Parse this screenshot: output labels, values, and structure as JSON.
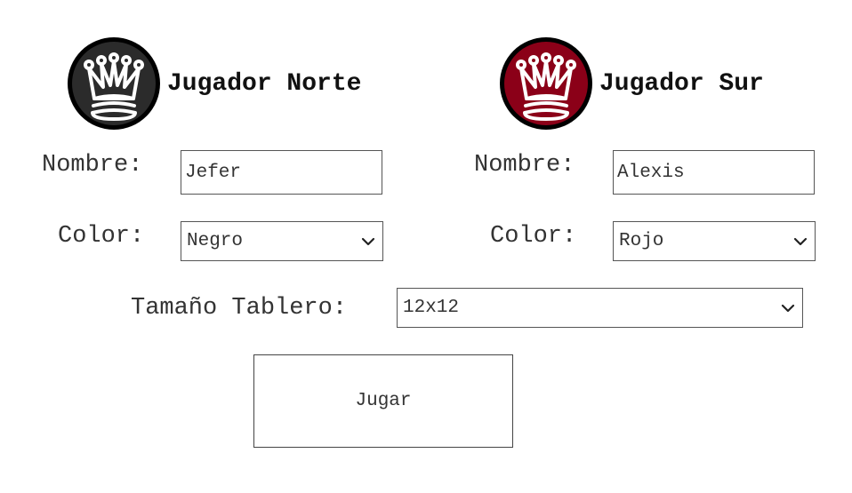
{
  "north": {
    "title": "Jugador Norte",
    "name_label": "Nombre:",
    "name_value": "Jefer",
    "color_label": "Color:",
    "color_value": "Negro",
    "badge_color": "#2b2b2b",
    "icon": "crown-icon"
  },
  "south": {
    "title": "Jugador Sur",
    "name_label": "Nombre:",
    "name_value": "Alexis",
    "color_label": "Color:",
    "color_value": "Rojo",
    "badge_color": "#8b0018",
    "icon": "crown-icon"
  },
  "board": {
    "label": "Tamaño Tablero:",
    "value": "12x12"
  },
  "play_button": {
    "label": "Jugar"
  }
}
